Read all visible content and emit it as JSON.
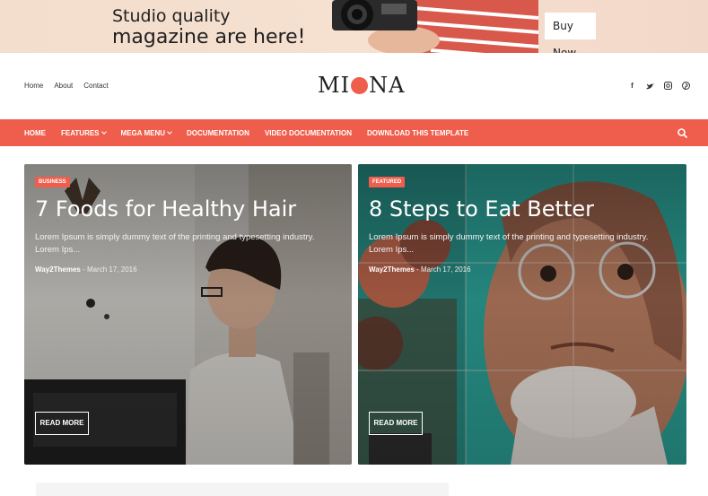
{
  "banner": {
    "line1": "Studio quality",
    "line2": "magazine are here!",
    "buy_label": "Buy Now"
  },
  "header": {
    "top_links": [
      "Home",
      "About",
      "Contact"
    ],
    "logo_left": "MI",
    "logo_right": "NA",
    "social_icons": [
      "facebook-icon",
      "twitter-icon",
      "instagram-icon",
      "pinterest-icon"
    ]
  },
  "nav": {
    "items": [
      {
        "label": "HOME",
        "dropdown": false
      },
      {
        "label": "FEATURES",
        "dropdown": true
      },
      {
        "label": "MEGA MENU",
        "dropdown": true
      },
      {
        "label": "DOCUMENTATION",
        "dropdown": false
      },
      {
        "label": "VIDEO DOCUMENTATION",
        "dropdown": false
      },
      {
        "label": "DOWNLOAD THIS TEMPLATE",
        "dropdown": false
      }
    ]
  },
  "posts": [
    {
      "badge": "BUSINESS",
      "title": "7 Foods for Healthy Hair",
      "excerpt": "Lorem Ipsum is simply dummy text of the printing and typesetting industry. Lorem Ips...",
      "author": "Way2Themes",
      "date": "- March 17, 2016",
      "read_more": "READ MORE"
    },
    {
      "badge": "FEATURED",
      "title": "8 Steps to Eat Better",
      "excerpt": "Lorem Ipsum is simply dummy text of the printing and typesetting industry. Lorem Ips...",
      "author": "Way2Themes",
      "date": "- March 17, 2016",
      "read_more": "READ MORE"
    }
  ],
  "colors": {
    "accent": "#ef5e4d",
    "banner_bg": "#f3ddcd"
  }
}
